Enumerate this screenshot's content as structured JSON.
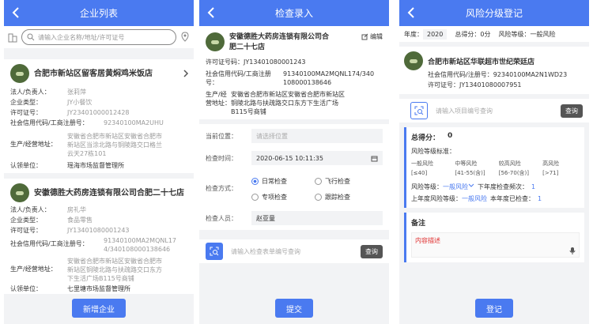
{
  "screen1": {
    "title": "企业列表",
    "search_placeholder": "请输入企业名称/地址/许可证号",
    "cards": [
      {
        "name": "合肥市新站区留客居黄焖鸡米饭店",
        "rows": [
          {
            "k": "法人/负责人：",
            "v": "张莉萍"
          },
          {
            "k": "企业类型：",
            "v": "JY小餐饮"
          },
          {
            "k": "许可证号：",
            "v": "JY23401000012428"
          },
          {
            "k": "社会信用代码/工商注册号：",
            "v": "92340100MA2UHU"
          },
          {
            "k": "生产/经营地址：",
            "v": "安徽省合肥市新站区安徽省合肥市新站区当涂北路与铜陵路交口格兰云天27栋101"
          },
          {
            "k": "认领单位：",
            "v": "瑶海市场监督管理所"
          }
        ]
      },
      {
        "name": "安徽德胜大药房连锁有限公司合肥二十七店",
        "rows": [
          {
            "k": "法人/负责人：",
            "v": "房礼华"
          },
          {
            "k": "企业类型：",
            "v": "食品零售"
          },
          {
            "k": "许可证号：",
            "v": "JY13401080001243"
          },
          {
            "k": "社会信用代码/工商注册号：",
            "v": "91340100MA2MQNL17 4/340108000138646"
          },
          {
            "k": "生产/经营地址：",
            "v": "安徽省合肥市新站区安徽省合肥市新站区铜陵北路与扶疏路交口东方下生活广场B115号商铺"
          },
          {
            "k": "认领单位：",
            "v": "七里塘市场监督管理所"
          }
        ]
      }
    ],
    "add_button": "新增企业"
  },
  "screen2": {
    "title": "检查录入",
    "company_name": "安徽德胜大药房连锁有限公司合肥二十七店",
    "edit_label": "编辑",
    "license_label": "许可证号码：",
    "license_value": "JY13401080001243",
    "credit_label": "社会信用代码/工商注册号：",
    "credit_value": "91340100MA2MQNL174/340108000138646",
    "address_label": "生产/经营地址：",
    "address_value": "安徽省合肥市新站区安徽省合肥市新站区铜陵北路与扶疏路交口东方下生活广场B115号商铺",
    "location_label": "当前位置：",
    "location_placeholder": "请选择位置",
    "time_label": "检查时间：",
    "time_value": "2020-06-15 10:11:35",
    "method_label": "检查方式：",
    "methods": [
      {
        "label": "日常检查",
        "checked": true
      },
      {
        "label": "飞行检查",
        "checked": false
      },
      {
        "label": "专项检查",
        "checked": false
      },
      {
        "label": "跟踪检查",
        "checked": false
      }
    ],
    "inspector_label": "检查人员：",
    "inspector_value": "赵亚童",
    "scan_placeholder": "请输入检查表单编号查询",
    "query_button": "查询",
    "submit_button": "提交"
  },
  "screen3": {
    "title": "风险分级登记",
    "year_label": "年度：",
    "year_value": "2020",
    "total_label": "总得分：",
    "total_value": "0分",
    "level_label": "风险等级：",
    "level_value": "一般风险",
    "company_name": "合肥市新站区华联超市世纪荣廷店",
    "credit_label": "社会信用代码/注册号：",
    "credit_value": "92340100MA2N1WD23",
    "license_label": "许可证号：",
    "license_value": "JY13401080007951",
    "scan_placeholder": "请输入项目编号查询",
    "query_button": "查询",
    "score_label": "总得分：",
    "score_value": "0",
    "standard_label": "风险等级标准：",
    "standards": [
      {
        "name": "一般风险",
        "range": "[≤40]"
      },
      {
        "name": "中等风险",
        "range": "[41-55(含)]"
      },
      {
        "name": "较高风险",
        "range": "[56-70(含)]"
      },
      {
        "name": "高风险",
        "range": "[>71]"
      }
    ],
    "risk_level_label": "风险等级：",
    "risk_level_value": "一般风险",
    "freq_label": "下年度检查频次：",
    "freq_value": "1",
    "last_level_label": "上年度风险等级：",
    "last_level_value": "一般风险",
    "done_label": "本年度已检查：",
    "done_value": "1",
    "remark_label": "备注",
    "remark_placeholder": "内容描述",
    "register_button": "登记"
  }
}
